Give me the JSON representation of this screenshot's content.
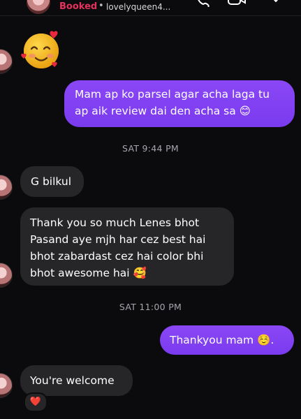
{
  "header": {
    "status": "Booked",
    "separator": "•",
    "username": "lovelyqueen4..."
  },
  "messages": [
    {
      "side": "in",
      "emoji": "🥰"
    },
    {
      "side": "out",
      "line1": "Mam ap ko parsel agar acha laga tu",
      "line2": "ap aik review dai den acha sa 😊"
    },
    {
      "stamp": "SAT 9:44 PM"
    },
    {
      "side": "in",
      "text": "G bilkul"
    },
    {
      "side": "in",
      "line1": "Thank you so much Lenes bhot",
      "line2": "Pasand aye mjh har cez best hai",
      "line3": "bhot zabardast cez hai color bhi",
      "line4": "bhot awesome hai 🥰"
    },
    {
      "stamp": "SAT 11:00 PM"
    },
    {
      "side": "out",
      "text": "Thankyou mam ☺️."
    },
    {
      "side": "in",
      "text": "You're welcome",
      "reaction": "❤️"
    }
  ],
  "colors": {
    "background": "#0b0b0e",
    "incoming": "#262629",
    "outgoing": "#7e3df3",
    "booked": "#e2315d"
  },
  "icons": [
    "phone-icon",
    "video-icon",
    "heart-icon"
  ]
}
